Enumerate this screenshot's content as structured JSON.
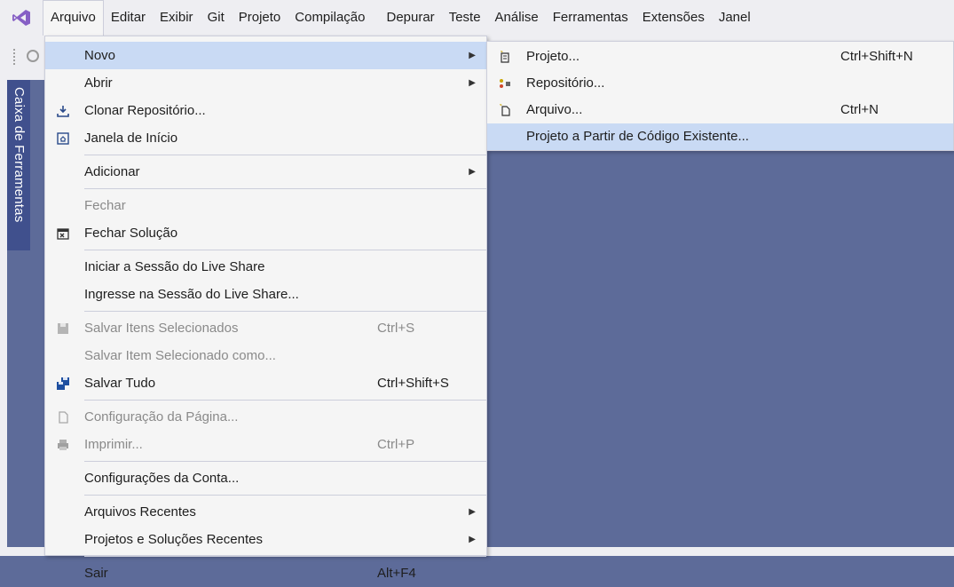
{
  "menubar": {
    "items": [
      "Arquivo",
      "Editar",
      "Exibir",
      "Git",
      "Projeto",
      "Compilação",
      "Depurar",
      "Teste",
      "Análise",
      "Ferramentas",
      "Extensões",
      "Janel"
    ]
  },
  "toolbox": {
    "label": "Caixa de Ferramentas"
  },
  "file_menu": {
    "new": "Novo",
    "open": "Abrir",
    "clone": "Clonar Repositório...",
    "start_window": "Janela de Início",
    "add": "Adicionar",
    "close": "Fechar",
    "close_solution": "Fechar Solução",
    "live_share_start": "Iniciar a Sessão do Live Share",
    "live_share_join": "Ingresse na Sessão do Live Share...",
    "save_selected": "Salvar Itens Selecionados",
    "save_selected_sc": "Ctrl+S",
    "save_selected_as": "Salvar Item Selecionado como...",
    "save_all": "Salvar Tudo",
    "save_all_sc": "Ctrl+Shift+S",
    "page_setup": "Configuração da Página...",
    "print": "Imprimir...",
    "print_sc": "Ctrl+P",
    "account_settings": "Configurações da Conta...",
    "recent_files": "Arquivos Recentes",
    "recent_projects": "Projetos e Soluções Recentes",
    "exit": "Sair",
    "exit_sc": "Alt+F4"
  },
  "new_submenu": {
    "project": "Projeto...",
    "project_sc": "Ctrl+Shift+N",
    "repository": "Repositório...",
    "file": "Arquivo...",
    "file_sc": "Ctrl+N",
    "from_existing": "Projeto a Partir de Código Existente..."
  },
  "colors": {
    "background": "#5d6b99",
    "menu_bg": "#f5f5f5",
    "highlight": "#c9daf4",
    "vs_purple": "#865fc5",
    "toolbox_tab": "#40508d"
  }
}
